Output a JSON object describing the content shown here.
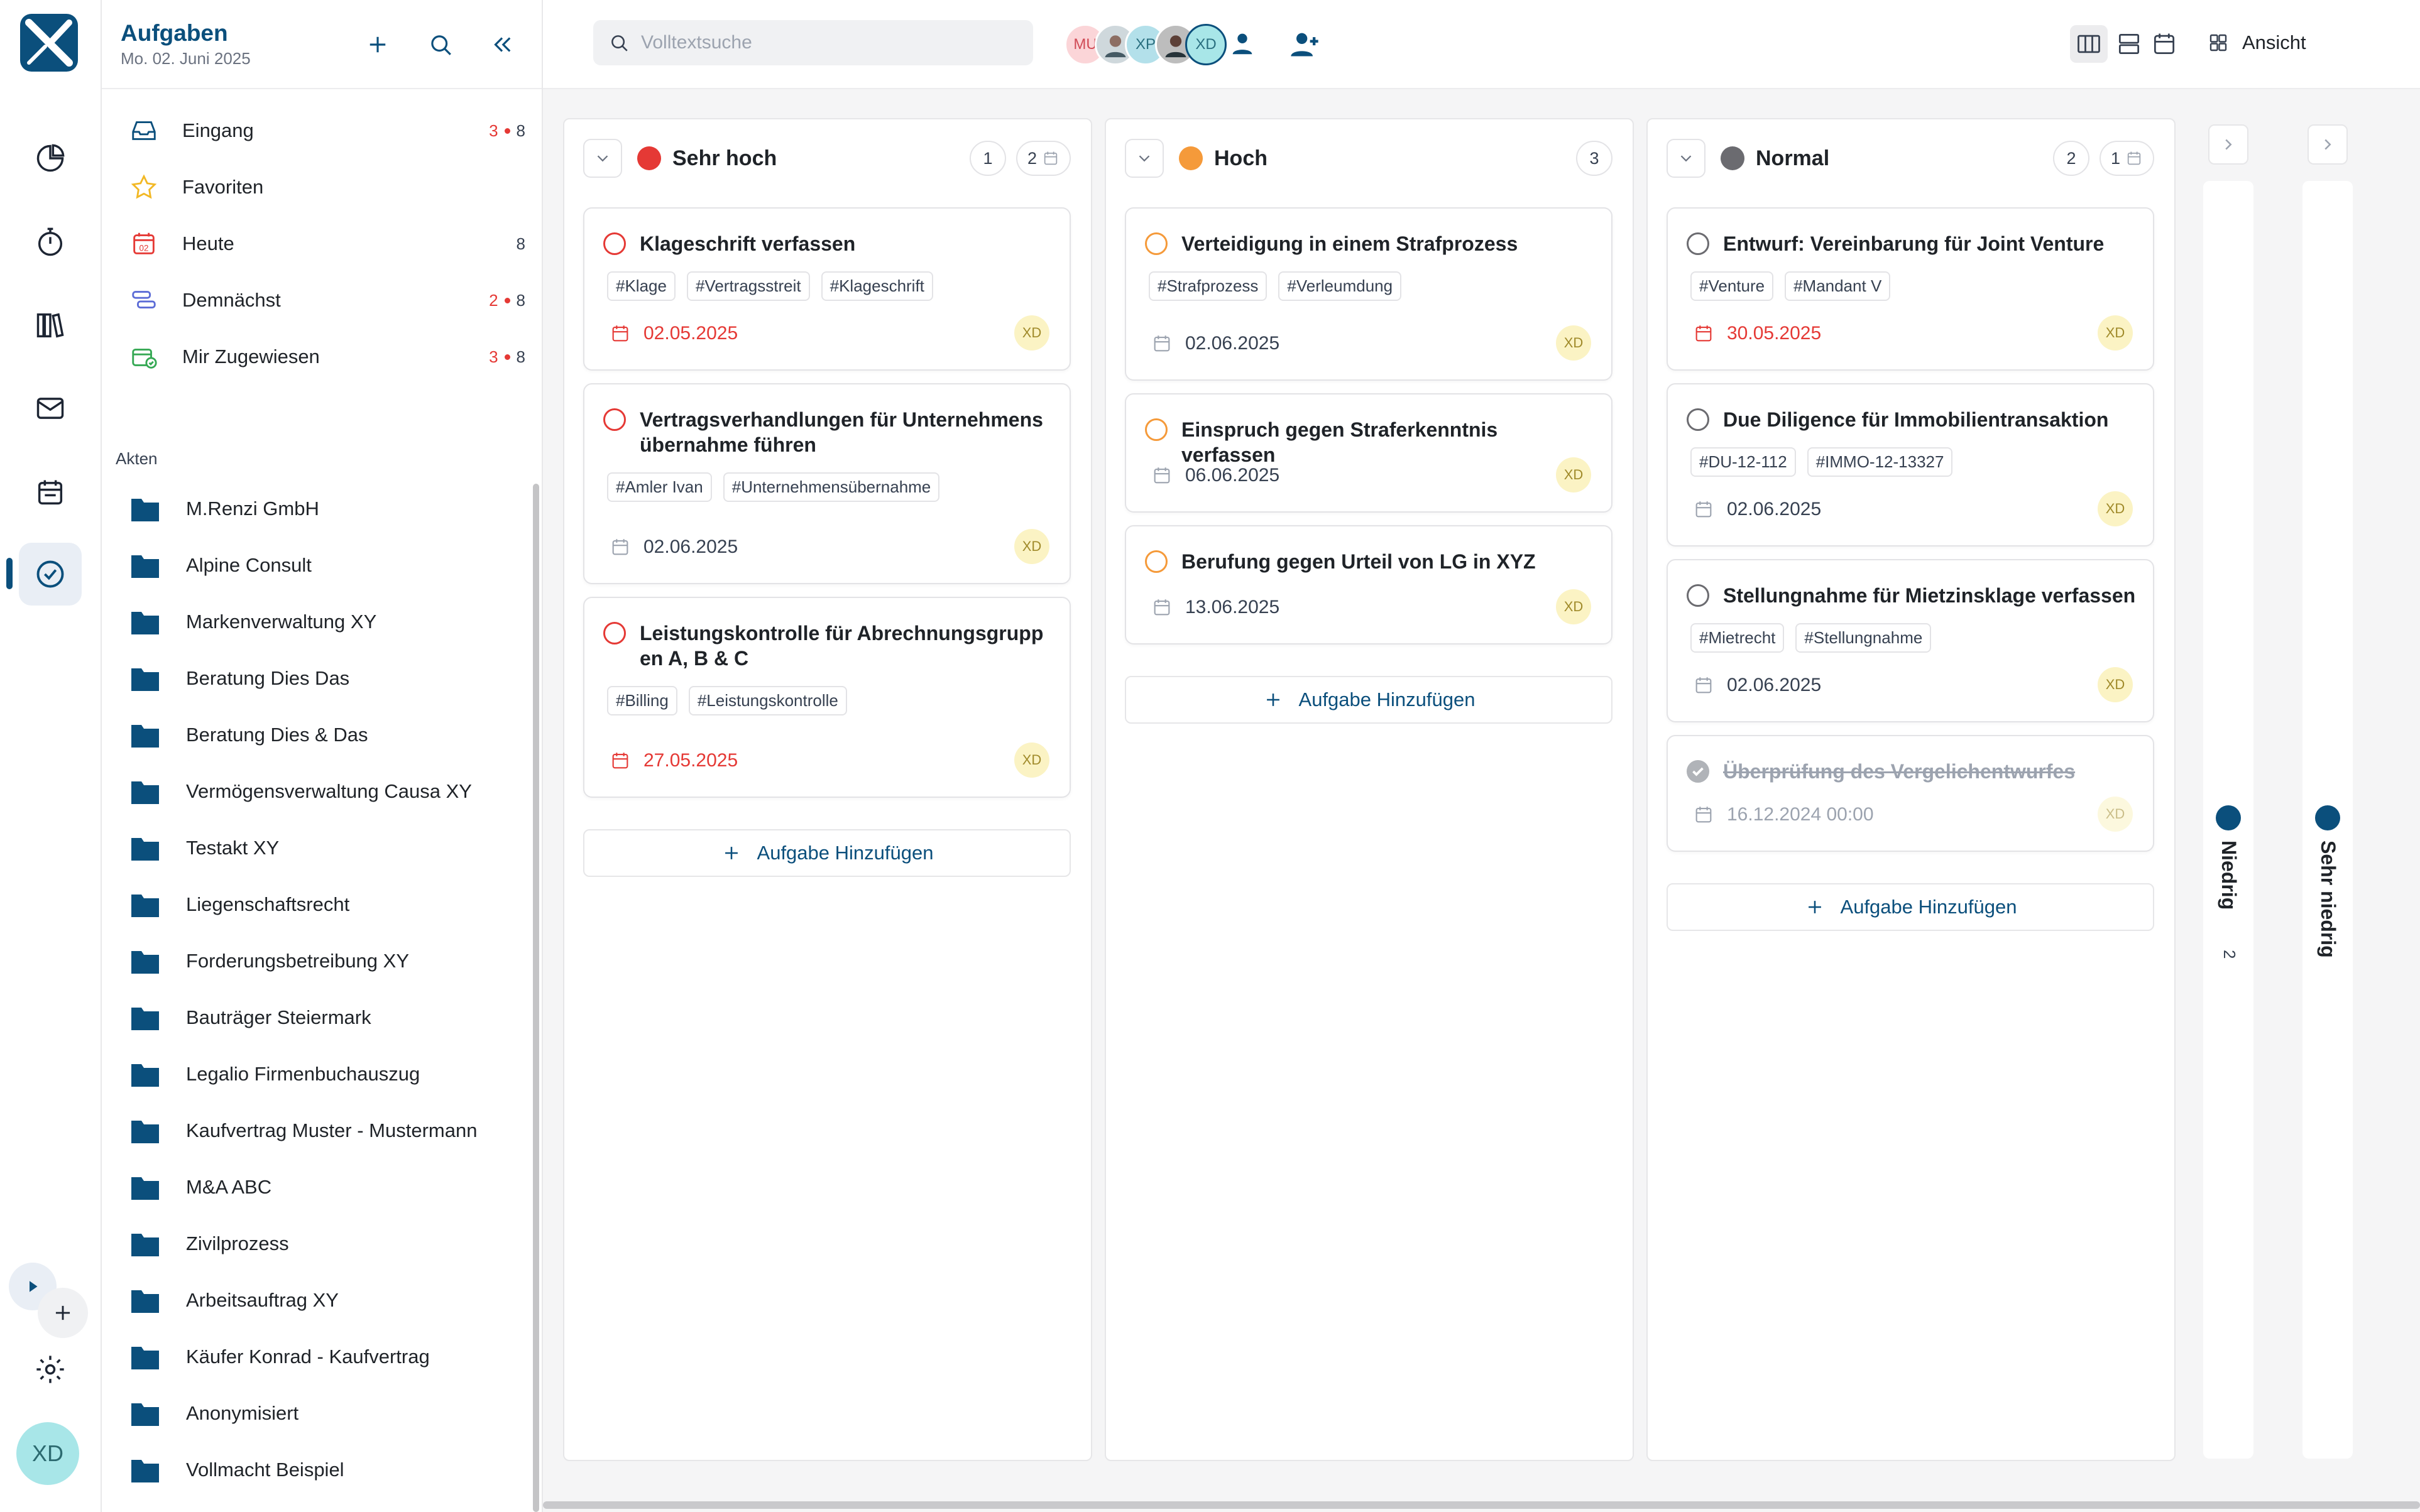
{
  "header": {
    "title": "Aufgaben",
    "date": "Mo. 02. Juni 2025"
  },
  "nav": [
    {
      "label": "Eingang",
      "red": "3",
      "count": "8",
      "icon": "inbox-icon"
    },
    {
      "label": "Favoriten",
      "red": "",
      "count": "",
      "icon": "star-icon"
    },
    {
      "label": "Heute",
      "red": "",
      "count": "8",
      "icon": "calendar-today-icon"
    },
    {
      "label": "Demnächst",
      "red": "2",
      "count": "8",
      "icon": "upcoming-icon"
    },
    {
      "label": "Mir Zugewiesen",
      "red": "3",
      "count": "8",
      "icon": "assigned-icon"
    }
  ],
  "akten": {
    "label": "Akten",
    "items": [
      "M.Renzi GmbH",
      "Alpine Consult",
      "Markenverwaltung XY",
      "Beratung Dies Das",
      "Beratung Dies & Das",
      "Vermögensverwaltung Causa XY",
      "Testakt XY",
      "Liegenschaftsrecht",
      "Forderungsbetreibung XY",
      "Bauträger Steiermark",
      "Legalio Firmenbuchauszug",
      "Kaufvertrag Muster - Mustermann",
      "M&A ABC",
      "Zivilprozess",
      "Arbeitsauftrag XY",
      "Käufer Konrad - Kaufvertrag",
      "Anonymisiert",
      "Vollmacht Beispiel"
    ]
  },
  "search": {
    "placeholder": "Volltextsuche"
  },
  "avatars": [
    "MU",
    "XP",
    "XD"
  ],
  "rail": {
    "user_initials": "XD"
  },
  "view": {
    "label": "Ansicht"
  },
  "colors": {
    "accent": "#0b4f7c",
    "very_high": "#e53935",
    "high": "#f59a3a",
    "normal": "#6b6b70",
    "low": "#0b4f7c"
  },
  "columns": [
    {
      "title": "Sehr hoch",
      "count": "1",
      "scheduled": "2",
      "add_label": "Aufgabe Hinzufügen",
      "cards": [
        {
          "title": "Klageschrift verfassen",
          "tags": [
            "#Klage",
            "#Vertragsstreit",
            "#Klageschrift"
          ],
          "date": "02.05.2025",
          "assignee": "XD"
        },
        {
          "title": "Vertragsverhandlungen für Unternehmens übernahme führen",
          "tags": [
            "#Amler Ivan",
            "#Unternehmensübernahme"
          ],
          "date": "02.06.2025",
          "assignee": "XD"
        },
        {
          "title": "Leistungskontrolle für Abrechnungsgrupp en A, B & C",
          "tags": [
            "#Billing",
            "#Leistungskontrolle"
          ],
          "date": "27.05.2025",
          "assignee": "XD"
        }
      ]
    },
    {
      "title": "Hoch",
      "count": "3",
      "add_label": "Aufgabe Hinzufügen",
      "cards": [
        {
          "title": "Verteidigung in einem Strafprozess",
          "tags": [
            "#Strafprozess",
            "#Verleumdung"
          ],
          "date": "02.06.2025",
          "assignee": "XD"
        },
        {
          "title": "Einspruch gegen Straferkenntnis verfassen",
          "tags": [],
          "date": "06.06.2025",
          "assignee": "XD"
        },
        {
          "title": "Berufung gegen Urteil von LG in XYZ",
          "tags": [],
          "date": "13.06.2025",
          "assignee": "XD"
        }
      ]
    },
    {
      "title": "Normal",
      "count": "2",
      "scheduled": "1",
      "add_label": "Aufgabe Hinzufügen",
      "cards": [
        {
          "title": "Entwurf: Vereinbarung für Joint Venture",
          "tags": [
            "#Venture",
            "#Mandant V"
          ],
          "date": "30.05.2025",
          "assignee": "XD"
        },
        {
          "title": "Due Diligence für Immobilientransaktion",
          "tags": [
            "#DU-12-112",
            "#IMMO-12-13327"
          ],
          "date": "02.06.2025",
          "assignee": "XD"
        },
        {
          "title": "Stellungnahme für Mietzinsklage verfassen",
          "tags": [
            "#Mietrecht",
            "#Stellungnahme"
          ],
          "date": "02.06.2025",
          "assignee": "XD"
        },
        {
          "title": "Überprüfung des Vergelichentwurfes",
          "tags": [],
          "date": "16.12.2024 00:00",
          "assignee": "XD",
          "done": true
        }
      ]
    }
  ],
  "collapsed": [
    {
      "title": "Niedrig",
      "count": "2"
    },
    {
      "title": "Sehr niedrig",
      "count": ""
    }
  ]
}
